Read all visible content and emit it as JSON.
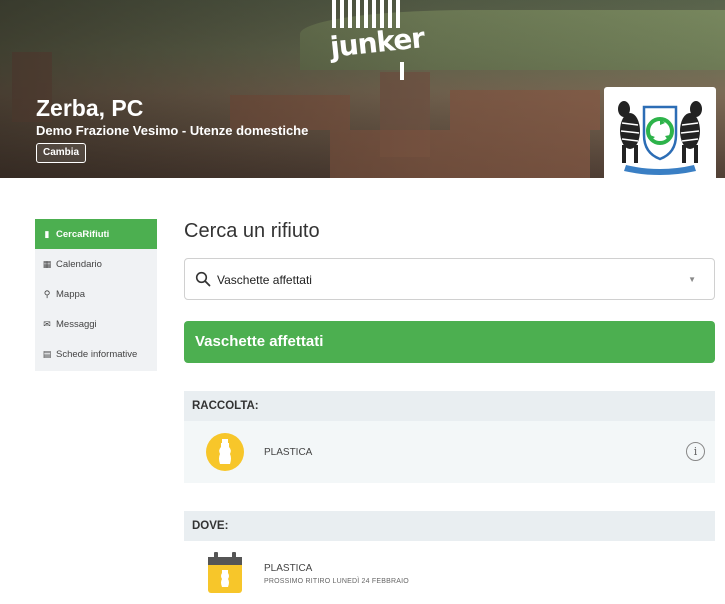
{
  "header": {
    "brand": "junker",
    "town": "Zerba, PC",
    "subtitle": "Demo Frazione Vesimo - Utenze domestiche",
    "change_label": "Cambia"
  },
  "sidebar": {
    "items": [
      {
        "label": "CercaRifiuti",
        "icon": "bottle-icon",
        "active": true
      },
      {
        "label": "Calendario",
        "icon": "calendar-icon"
      },
      {
        "label": "Mappa",
        "icon": "map-pin-icon"
      },
      {
        "label": "Messaggi",
        "icon": "mail-icon"
      },
      {
        "label": "Schede informative",
        "icon": "document-icon"
      }
    ]
  },
  "main": {
    "title": "Cerca un rifiuto",
    "search_value": "Vaschette affettati",
    "result_title": "Vaschette affettati",
    "raccolta": {
      "heading": "RACCOLTA:",
      "item": "PLASTICA"
    },
    "dove": {
      "heading": "DOVE:",
      "item": "PLASTICA",
      "next_pickup": "PROSSIMO RITIRO LUNEDÌ 24 FEBBRAIO"
    }
  },
  "colors": {
    "accent": "#4caf50",
    "plastic": "#f7c62a"
  }
}
